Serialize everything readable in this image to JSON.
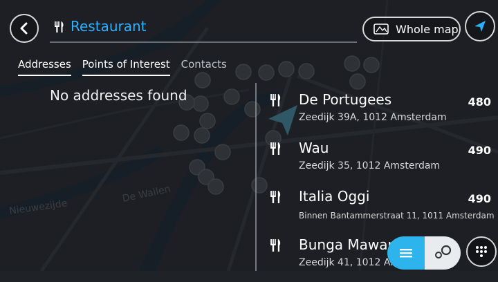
{
  "search": {
    "query": "Restaurant",
    "scope_label": "Whole map"
  },
  "tabs": [
    {
      "label": "Addresses"
    },
    {
      "label": "Points of Interest",
      "active": true
    },
    {
      "label": "Contacts"
    }
  ],
  "empty_message": "No addresses found",
  "results": [
    {
      "name": "De Portugees",
      "address": "Zeedijk 39A, 1012 Amsterdam",
      "distance": "480"
    },
    {
      "name": "Wau",
      "address": "Zeedijk 35, 1012 Amsterdam",
      "distance": "490"
    },
    {
      "name": "Italia Oggi",
      "address": "Binnen Bantammerstraat 11, 1011 Amsterdam",
      "distance": "490"
    },
    {
      "name": "Bunga Mawar",
      "address": "Zeedijk 41, 1012 Am",
      "distance": ""
    }
  ],
  "map": {
    "labels": [
      "De Wallen",
      "Nieuwezijde"
    ]
  },
  "icons": {
    "back": "back-arrow-icon",
    "poi": "restaurant-icon",
    "scope": "map-icon",
    "location": "location-arrow-icon",
    "list": "list-icon",
    "map_view": "map-pins-icon",
    "keyboard": "keyboard-icon"
  },
  "colors": {
    "accent": "#2ab2ff",
    "toggle_active": "#2db4ec"
  }
}
